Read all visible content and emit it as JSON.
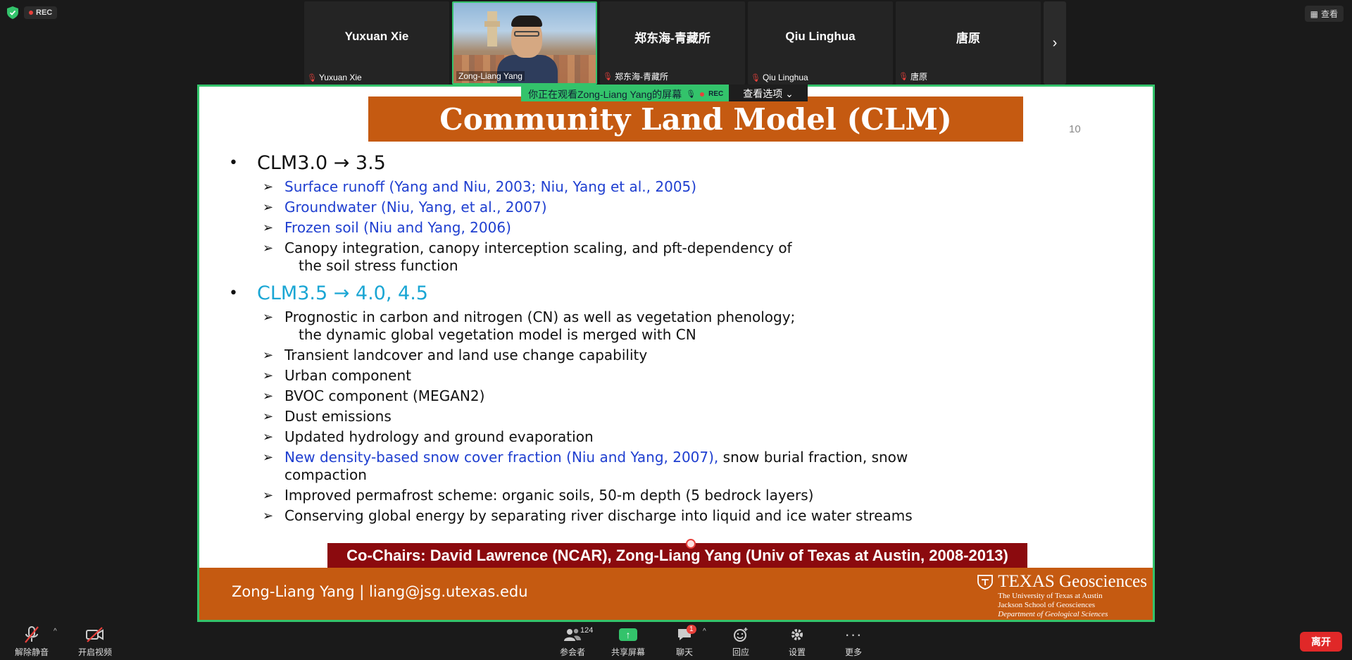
{
  "app": {
    "rec_label": "REC",
    "view_label": "查看",
    "colors": {
      "accent_green": "#33c36b",
      "record_red": "#e8403b",
      "slide_orange": "#c55a11",
      "cochair_red": "#8b0a0e",
      "leave_red": "#e02828"
    }
  },
  "participants": [
    {
      "name": "Yuxuan Xie",
      "label": "Yuxuan Xie",
      "muted": true
    },
    {
      "name": "",
      "label": "Zong-Liang Yang",
      "muted": false,
      "video": true
    },
    {
      "name": "郑东海-青藏所",
      "label": "郑东海-青藏所",
      "muted": true
    },
    {
      "name": "Qiu Linghua",
      "label": "Qiu Linghua",
      "muted": true
    },
    {
      "name": "唐原",
      "label": "唐原",
      "muted": true
    }
  ],
  "share_banner": {
    "text": "你正在观看Zong-Liang Yang的屏幕",
    "rec": "REC",
    "options_label": "查看选项"
  },
  "slide": {
    "title": "Community Land Model (CLM)",
    "page_number": "10",
    "sections": [
      {
        "heading": "CLM3.0 → 3.5",
        "items": [
          {
            "text": "Surface runoff (Yang and Niu, 2003; Niu, Yang et al., 2005)"
          },
          {
            "text": "Groundwater (Niu, Yang, et al., 2007)"
          },
          {
            "text": "Frozen soil (Niu and Yang, 2006)"
          },
          {
            "text": "Canopy integration, canopy interception scaling, and pft-dependency of",
            "cont": "the soil stress function"
          }
        ]
      },
      {
        "heading": "CLM3.5 → 4.0, 4.5",
        "items": [
          {
            "text": "Prognostic in carbon and nitrogen (CN) as well as vegetation phenology;",
            "cont": "the dynamic global vegetation model is merged with CN"
          },
          {
            "text": "Transient landcover and land use change capability"
          },
          {
            "text": "Urban component"
          },
          {
            "text": "BVOC component (MEGAN2)"
          },
          {
            "text": "Dust emissions"
          },
          {
            "text": "Updated hydrology and ground evaporation"
          },
          {
            "blue": "New density-based snow cover fraction (Niu and Yang, 2007),",
            "text": " snow burial fraction, snow",
            "cont": "compaction"
          },
          {
            "text": "Improved permafrost scheme: organic soils, 50-m depth (5 bedrock layers)"
          },
          {
            "text": "Conserving global energy by separating river discharge into liquid and ice water streams"
          }
        ]
      }
    ],
    "cochairs": "Co-Chairs: David Lawrence (NCAR), Zong-Liang Yang (Univ of Texas at Austin, 2008-2013)",
    "footer_author": "Zong-Liang Yang |  liang@jsg.utexas.edu",
    "brand": {
      "title": "TEXAS Geosciences",
      "line1": "The University of Texas at Austin",
      "line2": "Jackson School of Geosciences",
      "line3": "Department of Geological Sciences"
    }
  },
  "toolbar": {
    "unmute": "解除静音",
    "start_video": "开启视频",
    "participants": "参会者",
    "participants_count": "124",
    "share": "共享屏幕",
    "chat": "聊天",
    "chat_badge": "1",
    "reactions": "回应",
    "settings": "设置",
    "more": "更多",
    "leave": "离开"
  }
}
